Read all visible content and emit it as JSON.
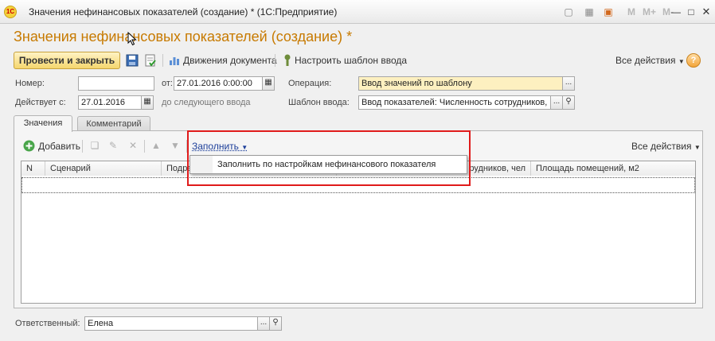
{
  "window": {
    "title": "Значения нефинансовых показателей (создание) * (1С:Предприятие)",
    "logo": "1С",
    "m_buttons": [
      "M",
      "M+",
      "M-"
    ]
  },
  "form": {
    "title": "Значения нефинансовых показателей (создание) *",
    "toolbar": {
      "post_close": "Провести и закрыть",
      "movements": "Движения документа",
      "template_setup": "Настроить шаблон ввода",
      "all_actions": "Все действия",
      "help": "?"
    },
    "fields": {
      "number_label": "Номер:",
      "number_value": "",
      "from_label": "от:",
      "from_value": "27.01.2016  0:00:00",
      "operation_label": "Операция:",
      "operation_value": "Ввод значений по шаблону",
      "valid_label": "Действует с:",
      "valid_value": "27.01.2016",
      "until_label": "до следующего ввода",
      "template_label": "Шаблон ввода:",
      "template_value": "Ввод показателей: Численность сотрудников,"
    },
    "tabs": [
      {
        "label": "Значения",
        "active": true
      },
      {
        "label": "Комментарий",
        "active": false
      }
    ],
    "table_toolbar": {
      "add": "Добавить",
      "fill": "Заполнить",
      "all_actions": "Все действия"
    },
    "columns": [
      "N",
      "Сценарий",
      "Подра",
      "рудников, чел",
      "Площадь помещений, м2"
    ],
    "dropdown": {
      "items": [
        "Заполнить по настройкам нефинансового показателя"
      ]
    },
    "responsible": {
      "label": "Ответственный:",
      "value": "Елена"
    }
  },
  "colors": {
    "title_orange": "#c77a00",
    "highlight_red": "#e01b1b",
    "accent_yellow": "#f5d66e"
  }
}
